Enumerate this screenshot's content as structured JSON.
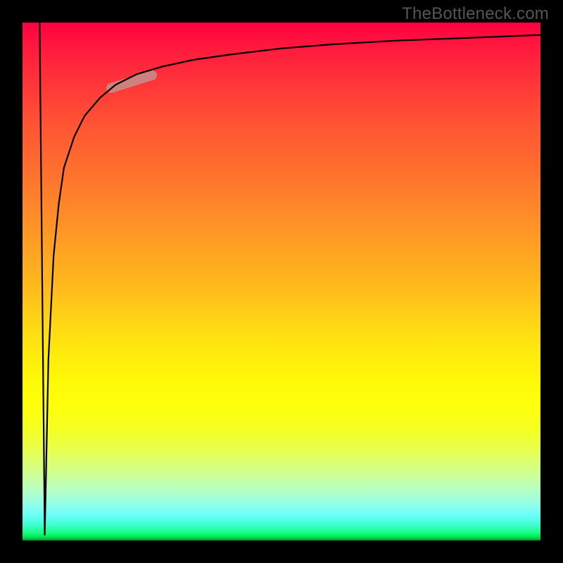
{
  "watermark": {
    "text": "TheBottleneck.com"
  },
  "colors": {
    "background_frame": "#000000",
    "curve": "#000000",
    "highlight": "#c88a85",
    "gradient_top": "#ff0040",
    "gradient_mid": "#ffe000",
    "gradient_bottom": "#00b040"
  },
  "chart_data": {
    "type": "line",
    "title": "",
    "xlabel": "",
    "ylabel": "",
    "xlim": [
      0,
      100
    ],
    "ylim": [
      0,
      100
    ],
    "grid": false,
    "legend": false,
    "annotations": [
      {
        "kind": "highlight_segment",
        "x_start": 17,
        "x_end": 25,
        "note": "short highlighted stretch on rising curve"
      }
    ],
    "series": [
      {
        "name": "down-stroke",
        "x": [
          3.3,
          4.3
        ],
        "y": [
          100,
          1
        ]
      },
      {
        "name": "main-curve",
        "x": [
          4.3,
          5,
          6,
          7,
          8,
          10,
          12,
          15,
          18,
          22,
          27,
          33,
          40,
          50,
          60,
          72,
          85,
          100
        ],
        "y": [
          1,
          35,
          55,
          65,
          72,
          78,
          82,
          85.5,
          88,
          90,
          91.5,
          92.8,
          93.8,
          95,
          95.8,
          96.5,
          97,
          97.6
        ]
      }
    ]
  }
}
